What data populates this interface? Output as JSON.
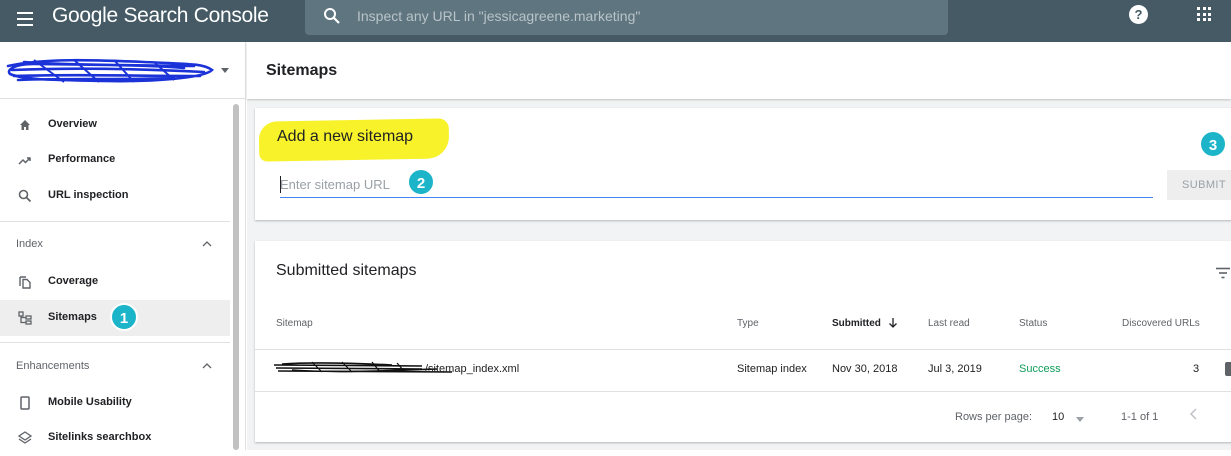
{
  "topbar": {
    "app_title": "Google Search Console",
    "search_placeholder": "Inspect any URL in \"jessicagreene.marketing\"",
    "help_glyph": "?",
    "icons": [
      "menu-icon",
      "search-icon",
      "help-icon",
      "apps-icon"
    ]
  },
  "sidebar": {
    "items_top": [
      {
        "label": "Overview",
        "icon": "home-icon"
      },
      {
        "label": "Performance",
        "icon": "trending-icon"
      },
      {
        "label": "URL inspection",
        "icon": "search-icon"
      }
    ],
    "index_section": {
      "label": "Index"
    },
    "index_items": [
      {
        "label": "Coverage",
        "icon": "copy-icon"
      },
      {
        "label": "Sitemaps",
        "icon": "sitemap-icon"
      }
    ],
    "enhancements_section": {
      "label": "Enhancements"
    },
    "enhancement_items": [
      {
        "label": "Mobile Usability",
        "icon": "phone-icon"
      },
      {
        "label": "Sitelinks searchbox",
        "icon": "layers-icon"
      }
    ]
  },
  "callouts": {
    "one": "1",
    "two": "2",
    "three": "3"
  },
  "colors": {
    "topbar": "#455a64",
    "callout": "#1cb4c8",
    "highlight": "#f8f22a",
    "success": "#0f9d58",
    "input_underline": "#4285f4"
  },
  "main": {
    "page_title": "Sitemaps",
    "add_card": {
      "title": "Add a new sitemap",
      "input_placeholder": "Enter sitemap URL",
      "input_value": "",
      "submit_label": "SUBMIT"
    },
    "submitted_card": {
      "title": "Submitted sitemaps",
      "columns": [
        "Sitemap",
        "Type",
        "Submitted",
        "Last read",
        "Status",
        "Discovered URLs"
      ],
      "sort_column": "Submitted",
      "rows": [
        {
          "sitemap": "/sitemap_index.xml",
          "type": "Sitemap index",
          "submitted": "Nov 30, 2018",
          "last_read": "Jul 3, 2019",
          "status": "Success",
          "discovered": "3"
        }
      ],
      "pagination": {
        "rows_per_page_label": "Rows per page:",
        "rows_per_page": "10",
        "range": "1-1 of 1"
      }
    }
  }
}
